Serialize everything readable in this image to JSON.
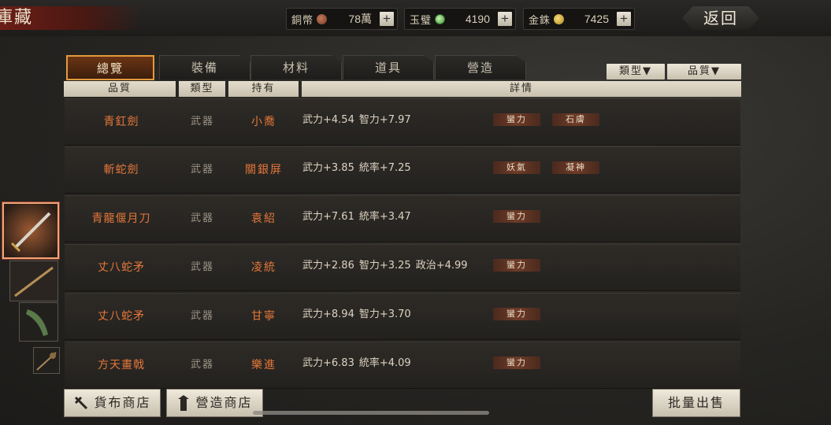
{
  "title": "庫藏",
  "back_label": "返回",
  "currencies": [
    {
      "label": "銅幣",
      "value": "78萬",
      "icon": "copper-coin-icon"
    },
    {
      "label": "玉璧",
      "value": "4190",
      "icon": "jade-disc-icon"
    },
    {
      "label": "金銖",
      "value": "7425",
      "icon": "gold-coin-icon"
    }
  ],
  "plus_label": "+",
  "tabs": [
    "總覽",
    "裝備",
    "材料",
    "道具",
    "營造"
  ],
  "active_tab": "總覽",
  "filters": {
    "type": "類型▼",
    "quality": "品質▼"
  },
  "columns": {
    "quality": "品質",
    "type": "類型",
    "owner": "持有",
    "details": "詳情"
  },
  "rows": [
    {
      "name": "青釭劍",
      "type": "武器",
      "owner": "小喬",
      "stats": [
        "武力+4.54",
        "智力+7.97"
      ],
      "skills": [
        "蠻力",
        "石膚"
      ]
    },
    {
      "name": "斬蛇劍",
      "type": "武器",
      "owner": "關銀屏",
      "stats": [
        "武力+3.85",
        "統率+7.25"
      ],
      "skills": [
        "妖氣",
        "凝神"
      ]
    },
    {
      "name": "青龍偃月刀",
      "type": "武器",
      "owner": "袁紹",
      "stats": [
        "武力+7.61",
        "統率+3.47"
      ],
      "skills": [
        "蠻力"
      ]
    },
    {
      "name": "丈八蛇矛",
      "type": "武器",
      "owner": "凌統",
      "stats": [
        "武力+2.86",
        "智力+3.25",
        "政治+4.99"
      ],
      "skills": [
        "蠻力"
      ]
    },
    {
      "name": "丈八蛇矛",
      "type": "武器",
      "owner": "甘寧",
      "stats": [
        "武力+8.94",
        "智力+3.70"
      ],
      "skills": [
        "蠻力"
      ]
    },
    {
      "name": "方天畫戟",
      "type": "武器",
      "owner": "樂進",
      "stats": [
        "武力+6.83",
        "統率+4.09"
      ],
      "skills": [
        "蠻力"
      ]
    }
  ],
  "bottom": {
    "currency_shop": "貨布商店",
    "build_shop": "營造商店",
    "bulk_sell": "批量出售"
  },
  "colors": {
    "accent": "#e39a3c",
    "name_orange": "#e5773a",
    "title_red": "#6a1e16"
  }
}
